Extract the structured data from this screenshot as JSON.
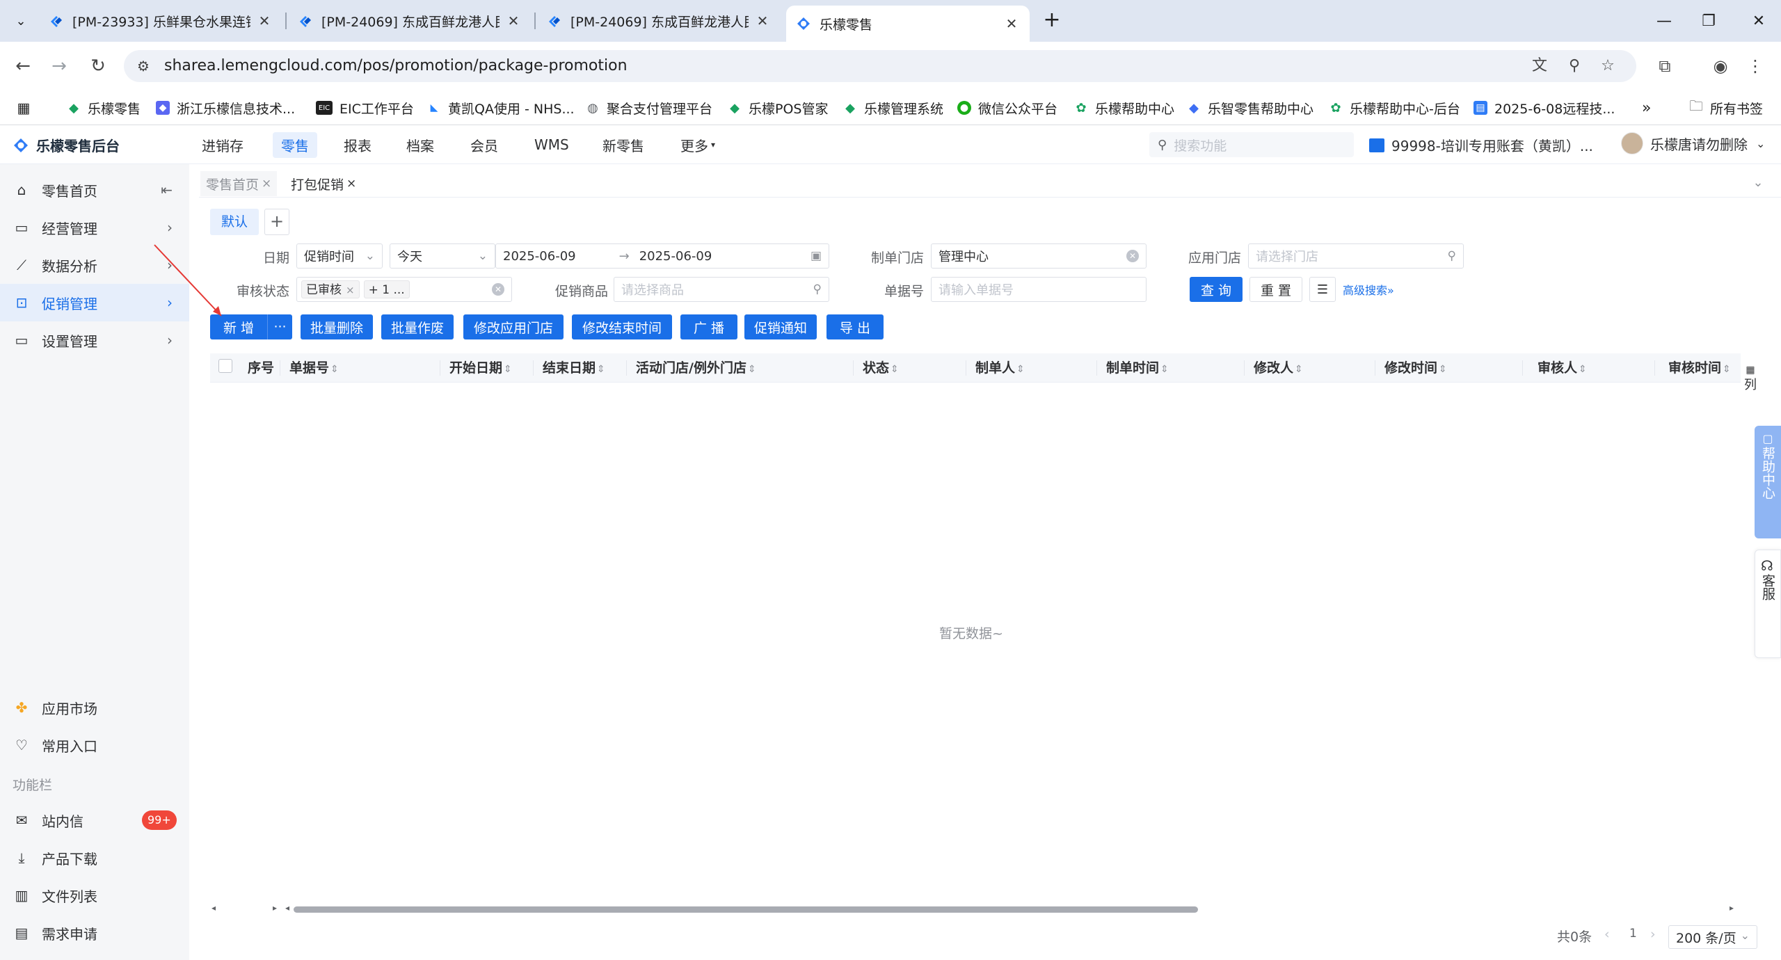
{
  "browser": {
    "tabs": [
      {
        "title": "[PM-23933] 乐鲜果仓水果连锁"
      },
      {
        "title": "[PM-24069] 东成百鲜龙港人民"
      },
      {
        "title": "[PM-24069] 东成百鲜龙港人民"
      },
      {
        "title": "乐檬零售"
      }
    ],
    "url": "sharea.lemengcloud.com/pos/promotion/package-promotion",
    "bookmarks": [
      "乐檬零售",
      "浙江乐檬信息技术...",
      "EIC工作平台",
      "黄凯QA使用 - NHS...",
      "聚合支付管理平台",
      "乐檬POS管家",
      "乐檬管理系统",
      "微信公众平台",
      "乐檬帮助中心",
      "乐智零售帮助中心",
      "乐檬帮助中心-后台",
      "2025-6-08远程技..."
    ],
    "all_bookmarks": "所有书签",
    "more": "»"
  },
  "app": {
    "logo": "乐檬零售后台",
    "nav": [
      "进销存",
      "零售",
      "报表",
      "档案",
      "会员",
      "WMS",
      "新零售",
      "更多"
    ],
    "nav_active": "零售",
    "search_placeholder": "搜索功能",
    "account": "99998-培训专用账套（黄凯）...",
    "user": "乐檬唐请勿删除"
  },
  "sidebar": {
    "items": [
      {
        "label": "零售首页"
      },
      {
        "label": "经营管理"
      },
      {
        "label": "数据分析"
      },
      {
        "label": "促销管理"
      },
      {
        "label": "设置管理"
      }
    ],
    "bottom": [
      {
        "label": "应用市场"
      },
      {
        "label": "常用入口"
      }
    ],
    "section": "功能栏",
    "func": [
      {
        "label": "站内信",
        "badge": "99+"
      },
      {
        "label": "产品下载"
      },
      {
        "label": "文件列表"
      },
      {
        "label": "需求申请"
      }
    ]
  },
  "pagetabs": [
    "零售首页",
    "打包促销"
  ],
  "scheme": {
    "default": "默认",
    "add": "+"
  },
  "filters": {
    "date_label": "日期",
    "date_type": "促销时间",
    "date_range_type": "今天",
    "date_start": "2025-06-09",
    "date_sep": "→",
    "date_end": "2025-06-09",
    "maker_store_label": "制单门店",
    "maker_store_value": "管理中心",
    "apply_store_label": "应用门店",
    "apply_store_placeholder": "请选择门店",
    "audit_label": "审核状态",
    "audit_tag": "已审核",
    "audit_more": "+ 1 ...",
    "goods_label": "促销商品",
    "goods_placeholder": "请选择商品",
    "bill_label": "单据号",
    "bill_placeholder": "请输入单据号",
    "query": "查 询",
    "reset": "重 置",
    "advanced": "高级搜索»"
  },
  "actions": {
    "add": "新 增",
    "more": "···",
    "batch_delete": "批量删除",
    "batch_void": "批量作废",
    "modify_store": "修改应用门店",
    "modify_end": "修改结束时间",
    "broadcast": "广 播",
    "notify": "促销通知",
    "export": "导 出"
  },
  "table": {
    "columns": [
      "序号",
      "单据号",
      "开始日期",
      "结束日期",
      "活动门店/例外门店",
      "状态",
      "制单人",
      "制单时间",
      "修改人",
      "修改时间",
      "审核人",
      "审核时间"
    ],
    "col_setting": "列",
    "empty": "暂无数据~"
  },
  "pagination": {
    "total": "共0条",
    "page": "1",
    "page_size": "200 条/页"
  },
  "floating": {
    "help": "帮助中心",
    "service": "客服"
  }
}
